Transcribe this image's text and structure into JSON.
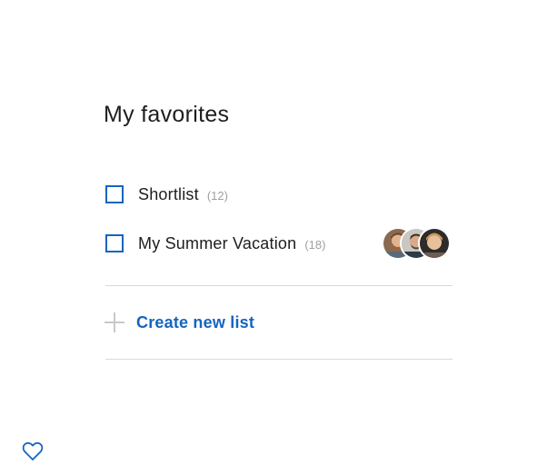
{
  "header": {
    "title": "My favorites"
  },
  "lists": [
    {
      "name": "Shortlist",
      "count": "(12)",
      "checked": false,
      "avatars": []
    },
    {
      "name": "My Summer Vacation",
      "count": "(18)",
      "checked": false,
      "avatars": [
        "avatar-1",
        "avatar-2",
        "avatar-3"
      ]
    }
  ],
  "actions": {
    "create_label": "Create new list"
  },
  "colors": {
    "accent": "#1565c0",
    "divider": "#d9d9d9",
    "count": "#a0a0a0"
  },
  "icons": {
    "create": "plus-icon",
    "footer": "heart-outline-icon"
  }
}
